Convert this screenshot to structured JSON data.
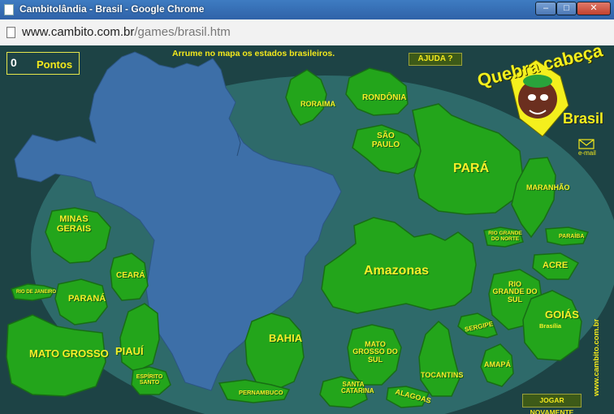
{
  "browser": {
    "window_title": "Cambitolândia - Brasil - Google Chrome",
    "url_host": "www.cambito.com.br",
    "url_path": "/games/brasil.htm",
    "buttons": {
      "minimize": "–",
      "maximize": "□",
      "close": "✕"
    }
  },
  "game": {
    "score_value": "0",
    "score_label": "Pontos",
    "instruction": "Arrume no mapa  os estados brasileiros.",
    "help_button": "AJUDA ?",
    "reset_button": "JOGAR NOVAMENTE",
    "logo": {
      "title": "Quebra cabeça",
      "subtitle": "Brasil"
    },
    "email_label": "e-mail",
    "site": "www.cambito.com.br",
    "colors": {
      "background": "#1d4345",
      "oval": "#2e6a6a",
      "map": "#3d6fa8",
      "piece": "#23a51b",
      "label": "#f7ef2a"
    },
    "states": {
      "roraima": "RORAIMA",
      "rondonia": "RONDÔNIA",
      "sao_paulo": "SÃO PAULO",
      "para": "PARÁ",
      "maranhao": "MARANHÃO",
      "minas_gerais": "MINAS GERAIS",
      "ceara": "CEARÁ",
      "rio_de_janeiro": "RIO DE JANEIRO",
      "parana": "PARANÁ",
      "amazonas": "Amazonas",
      "rio_grande_do_norte": "RIO GRANDE DO NORTE",
      "paraiba": "PARAÍBA",
      "acre": "ACRE",
      "rio_grande_do_sul": "RIO GRANDE DO SUL",
      "goias": "GOIÁS",
      "brasilia": "Brasília",
      "mato_grosso": "MATO GROSSO",
      "piaui": "PIAUÍ",
      "bahia": "BAHIA",
      "mato_grosso_do_sul": "MATO GROSSO DO SUL",
      "sergipe": "SERGIPE",
      "espirito_santo": "ESPÍRITO SANTO",
      "tocantins": "TOCANTINS",
      "amapa": "AMAPÁ",
      "pernambuco": "PERNAMBUCO",
      "santa_catarina": "SANTA CATARINA",
      "alagoas": "ALAGOAS"
    }
  }
}
